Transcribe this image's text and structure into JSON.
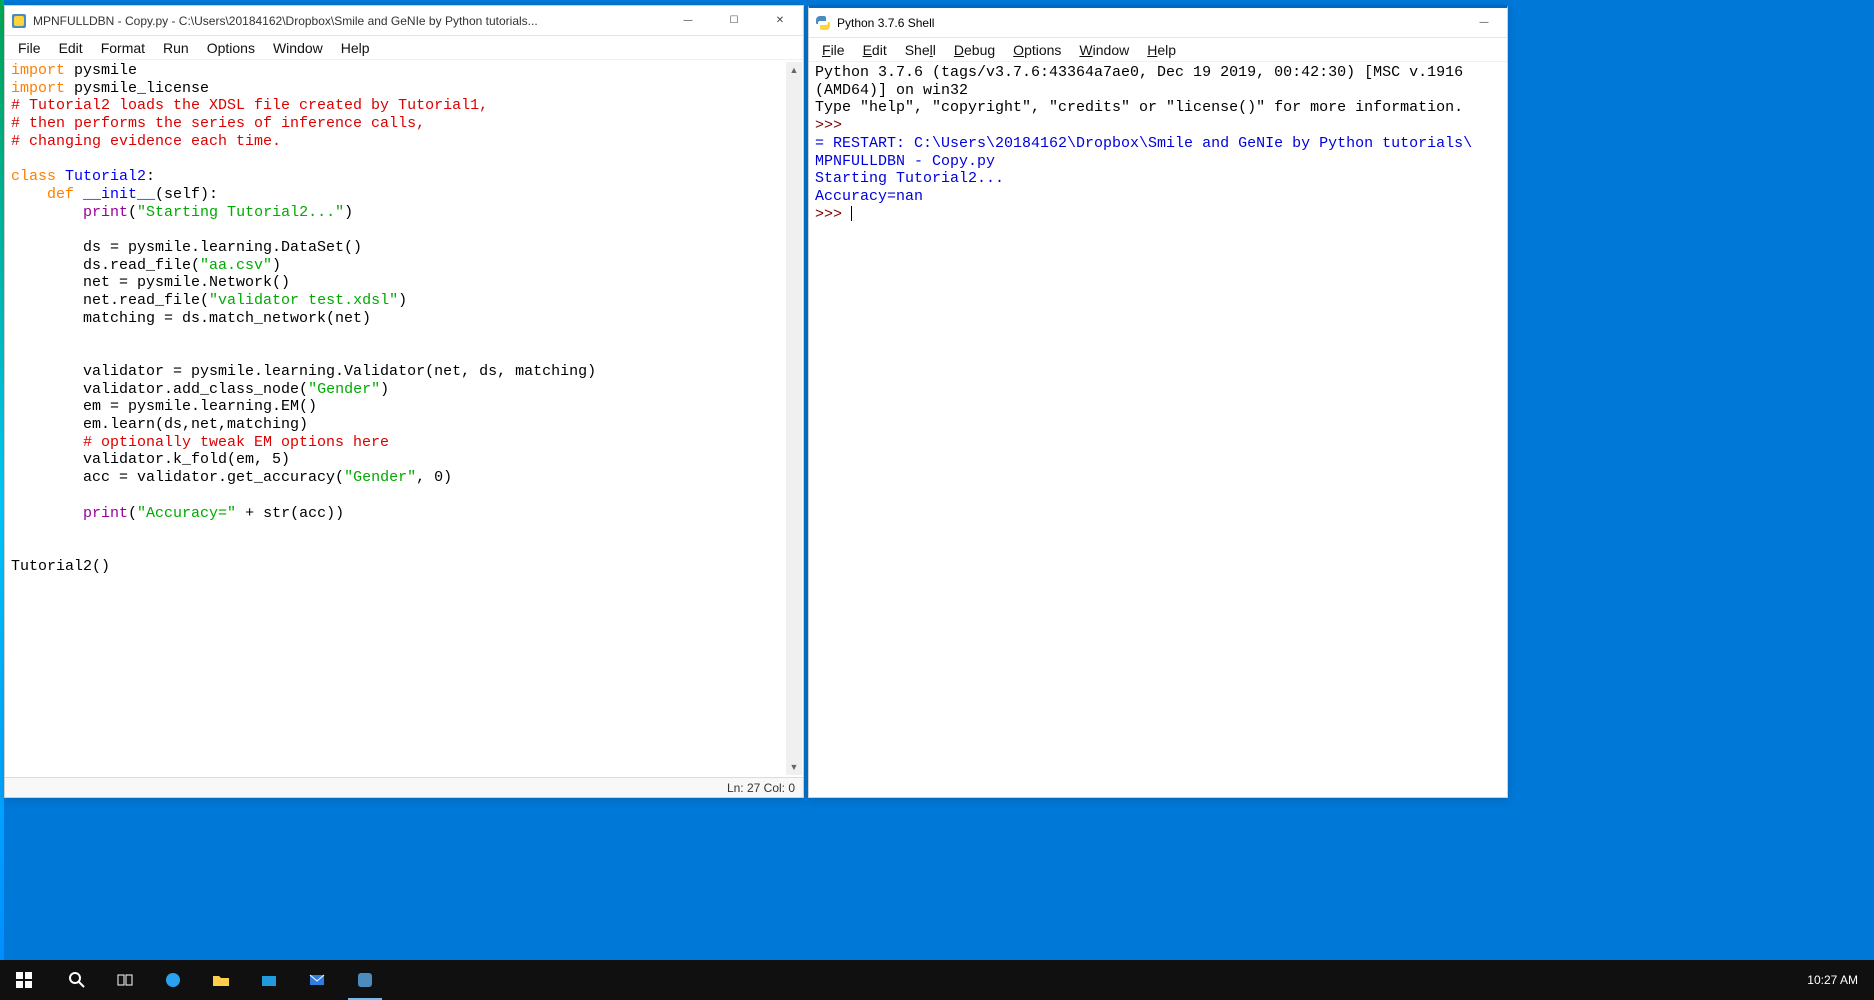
{
  "editor": {
    "title": "MPNFULLDBN - Copy.py - C:\\Users\\20184162\\Dropbox\\Smile and GeNIe by Python tutorials...",
    "menus": [
      "File",
      "Edit",
      "Format",
      "Run",
      "Options",
      "Window",
      "Help"
    ],
    "status": "Ln: 27  Col: 0",
    "code": {
      "l1a": "import",
      "l1b": " pysmile",
      "l2a": "import",
      "l2b": " pysmile_license",
      "l3": "# Tutorial2 loads the XDSL file created by Tutorial1,",
      "l4": "# then performs the series of inference calls,",
      "l5": "# changing evidence each time.",
      "l6": "",
      "l7a": "class ",
      "l7b": "Tutorial2",
      "l7c": ":",
      "l8a": "    ",
      "l8b": "def ",
      "l8c": "__init__",
      "l8d": "(self):",
      "l9a": "        ",
      "l9b": "print",
      "l9c": "(",
      "l9d": "\"Starting Tutorial2...\"",
      "l9e": ")",
      "l10": "",
      "l11": "        ds = pysmile.learning.DataSet()",
      "l12a": "        ds.read_file(",
      "l12b": "\"aa.csv\"",
      "l12c": ")",
      "l13": "        net = pysmile.Network()",
      "l14a": "        net.read_file(",
      "l14b": "\"validator test.xdsl\"",
      "l14c": ")",
      "l15": "        matching = ds.match_network(net)",
      "l16": "",
      "l17": "",
      "l18": "        validator = pysmile.learning.Validator(net, ds, matching)",
      "l19a": "        validator.add_class_node(",
      "l19b": "\"Gender\"",
      "l19c": ")",
      "l20": "        em = pysmile.learning.EM()",
      "l21": "        em.learn(ds,net,matching)",
      "l22": "        # optionally tweak EM options here",
      "l23": "        validator.k_fold(em, 5)",
      "l24a": "        acc = validator.get_accuracy(",
      "l24b": "\"Gender\"",
      "l24c": ", 0)",
      "l25": "",
      "l26a": "        ",
      "l26b": "print",
      "l26c": "(",
      "l26d": "\"Accuracy=\"",
      "l26e": " + str(acc))",
      "l27": "",
      "l28": "",
      "l29": "Tutorial2()"
    }
  },
  "shell": {
    "title": "Python 3.7.6 Shell",
    "menus": [
      "File",
      "Edit",
      "Shell",
      "Debug",
      "Options",
      "Window",
      "Help"
    ],
    "out": {
      "banner1": "Python 3.7.6 (tags/v3.7.6:43364a7ae0, Dec 19 2019, 00:42:30) [MSC v.1916",
      "banner2": "(AMD64)] on win32",
      "banner3": "Type \"help\", \"copyright\", \"credits\" or \"license()\" for more information.",
      "prompt1": ">>> ",
      "restart": "= RESTART: C:\\Users\\20184162\\Dropbox\\Smile and GeNIe by Python tutorials\\",
      "restart2": "MPNFULLDBN - Copy.py",
      "line1": "Starting Tutorial2...",
      "line2": "Accuracy=nan",
      "prompt2": ">>> "
    }
  },
  "taskbar": {
    "time": "10:27 AM"
  },
  "winbtn": {
    "min": "—",
    "max": "☐",
    "close": "✕"
  }
}
